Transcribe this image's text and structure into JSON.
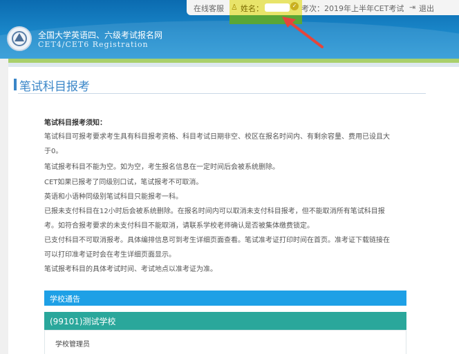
{
  "header": {
    "site_title": "全国大学英语四、六级考试报名网",
    "site_subtitle": "CET4/CET6  Registration",
    "online_service": "在线客服",
    "name_label": "姓名：",
    "exam_session": "考次：2019年上半年CET考试",
    "logout": "退出"
  },
  "page": {
    "title": "笔试科目报考"
  },
  "notice": {
    "heading": "笔试科目报考须知：",
    "lines": [
      "笔试科目可报考要求考生具有科目报考资格、科目考试日期非空、校区在报名时间内、有剩余容量、费用已设且大",
      "于0。",
      "笔试报考科目不能为空。如为空，考生报名信息在一定时间后会被系统删除。",
      "CET如果已报考了同级别口试，笔试报考不可取消。",
      "英语和小语种同级别笔试科目只能报考一科。",
      "已报未支付科目在12小时后会被系统删除。在报名时间内可以取消未支付科目报考，但不能取消所有笔试科目报",
      "考。如符合报考要求的未支付科目不能取消，请联系学校老师确认是否被集体缴费锁定。",
      "已支付科目不可取消报考。具体编排信息可到考生详细页面查看。笔试准考证打印时间在首页。准考证下载链接在",
      "可以打印准考证时会在考生详细页面显示。",
      "笔试报考科目的具体考试时间、考试地点以准考证为准。"
    ]
  },
  "bulletin": {
    "label": "学校通告",
    "school": "(99101)测试学校",
    "admin": "学校管理员"
  },
  "colors": {
    "header_blue": "#1a87c9",
    "accent_blue": "#3a86c8",
    "bulletin_blue": "#1ea0e6",
    "school_teal": "#2aa79b",
    "highlight_yellow": "#e8e46a",
    "highlight_green": "#5aa636",
    "arrow_red": "#e5453b"
  },
  "icons": [
    "user-icon",
    "password-icon",
    "logout-icon",
    "arrow-annotation"
  ]
}
